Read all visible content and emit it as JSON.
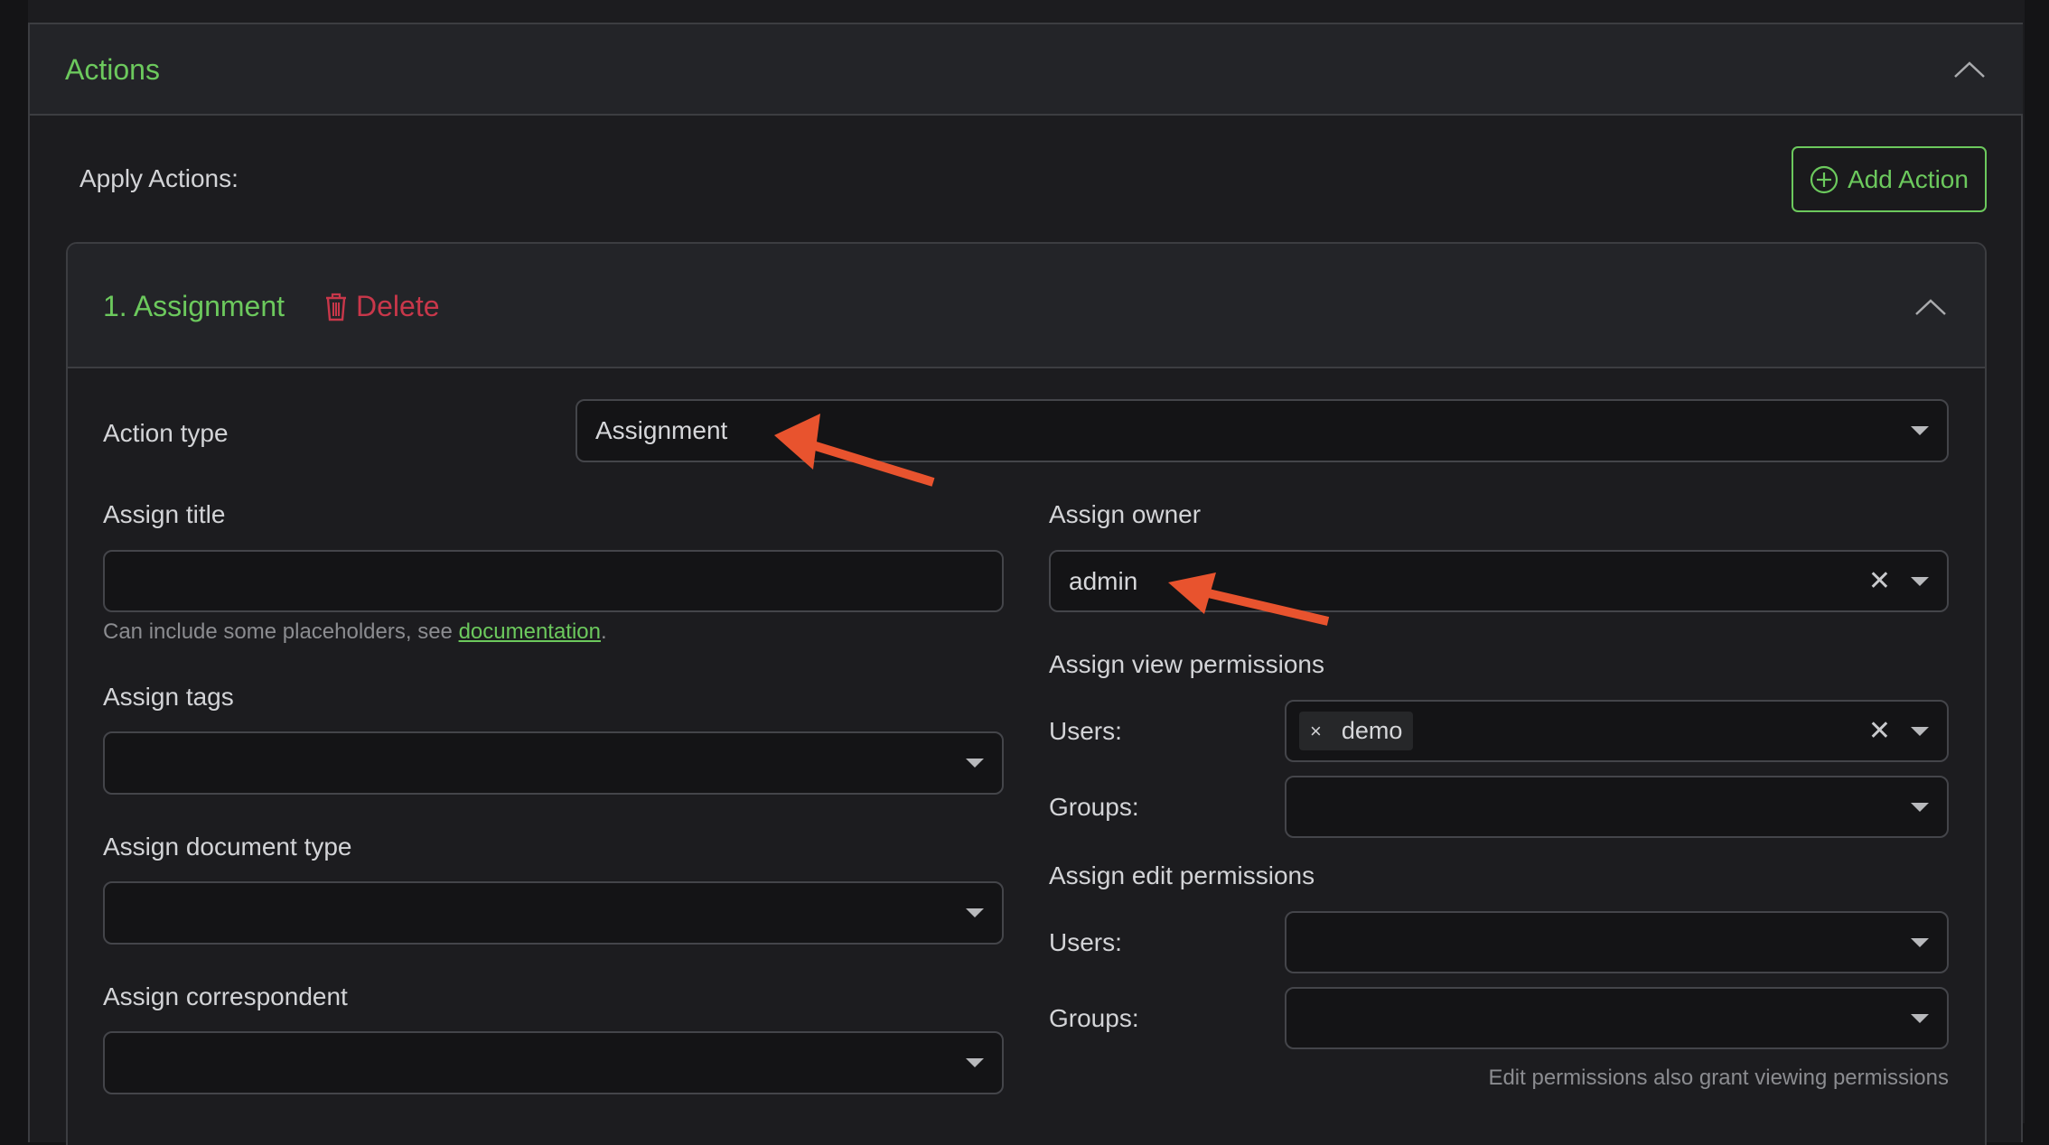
{
  "section": {
    "title": "Actions",
    "collapse_icon": "chevron-up-icon",
    "apply_label": "Apply Actions:",
    "add_button": {
      "label": "Add Action",
      "icon": "plus-circle-icon"
    }
  },
  "colors": {
    "accent_green": "#6cc95d",
    "danger_red": "#c8374a",
    "annotation_arrow": "#e8532e"
  },
  "action": {
    "title": "1. Assignment",
    "delete_label": "Delete",
    "delete_icon": "trash-icon",
    "collapse_icon": "chevron-up-icon",
    "action_type": {
      "label": "Action type",
      "value": "Assignment"
    },
    "assign_title": {
      "label": "Assign title",
      "value": "",
      "help_prefix": "Can include some placeholders, see ",
      "help_link": "documentation",
      "help_suffix": "."
    },
    "assign_tags": {
      "label": "Assign tags",
      "value": ""
    },
    "assign_document_type": {
      "label": "Assign document type",
      "value": ""
    },
    "assign_correspondent": {
      "label": "Assign correspondent",
      "value": ""
    },
    "assign_owner": {
      "label": "Assign owner",
      "value": "admin"
    },
    "view_permissions": {
      "label": "Assign view permissions",
      "users_label": "Users:",
      "users": [
        "demo"
      ],
      "groups_label": "Groups:",
      "groups": []
    },
    "edit_permissions": {
      "label": "Assign edit permissions",
      "users_label": "Users:",
      "users": [],
      "groups_label": "Groups:",
      "groups": [],
      "note": "Edit permissions also grant viewing permissions"
    }
  },
  "annotations": [
    {
      "type": "arrow",
      "points_to": "action-type-select"
    },
    {
      "type": "arrow",
      "points_to": "assign-owner-select"
    }
  ]
}
